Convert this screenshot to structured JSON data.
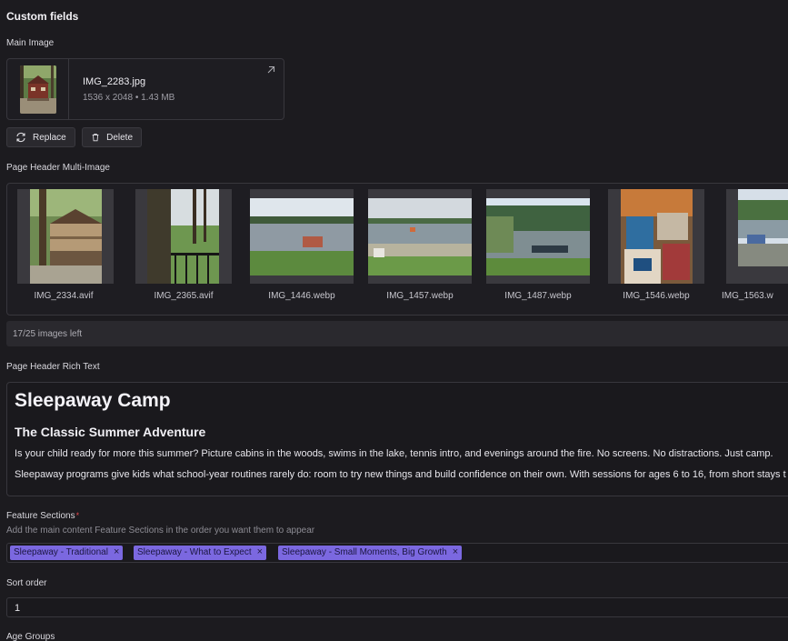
{
  "custom_fields": {
    "title": "Custom fields"
  },
  "main_image": {
    "label": "Main Image",
    "file_name": "IMG_2283.jpg",
    "meta": "1536 x 2048 • 1.43 MB",
    "open_icon": "external-link-icon",
    "replace_label": "Replace",
    "delete_label": "Delete"
  },
  "page_header_multi_image": {
    "label": "Page Header Multi-Image",
    "images": [
      {
        "name": "IMG_2334.avif"
      },
      {
        "name": "IMG_2365.avif"
      },
      {
        "name": "IMG_1446.webp"
      },
      {
        "name": "IMG_1457.webp"
      },
      {
        "name": "IMG_1487.webp"
      },
      {
        "name": "IMG_1546.webp"
      },
      {
        "name": "IMG_1563.w"
      }
    ],
    "remaining": "17/25 images left"
  },
  "page_header_rich_text": {
    "label": "Page Header Rich Text",
    "heading": "Sleepaway Camp",
    "subheading": "The Classic Summer Adventure",
    "paragraph_1": "Is your child ready for more this summer? Picture cabins in the woods, swims in the lake, tennis intro, and evenings around the fire. No screens. No distractions. Just camp.",
    "paragraph_2": "Sleepaway programs give kids what school-year routines rarely do: room to try new things and build confidence on their own. With sessions for ages 6 to 16, from short stays t"
  },
  "feature_sections": {
    "label": "Feature Sections",
    "required_mark": "*",
    "helper": "Add the main content Feature Sections in the order you want them to appear",
    "tags": [
      {
        "label": "Sleepaway - Traditional",
        "remove": "×"
      },
      {
        "label": "Sleepaway - What to Expect",
        "remove": "×"
      },
      {
        "label": "Sleepaway - Small Moments, Big Growth",
        "remove": "×"
      }
    ]
  },
  "sort_order": {
    "label": "Sort order",
    "value": "1"
  },
  "age_groups": {
    "label": "Age Groups"
  },
  "colors": {
    "background": "#1c1b1f",
    "border": "#38373d",
    "tag": "#7b68e0",
    "required": "#e5484d"
  }
}
